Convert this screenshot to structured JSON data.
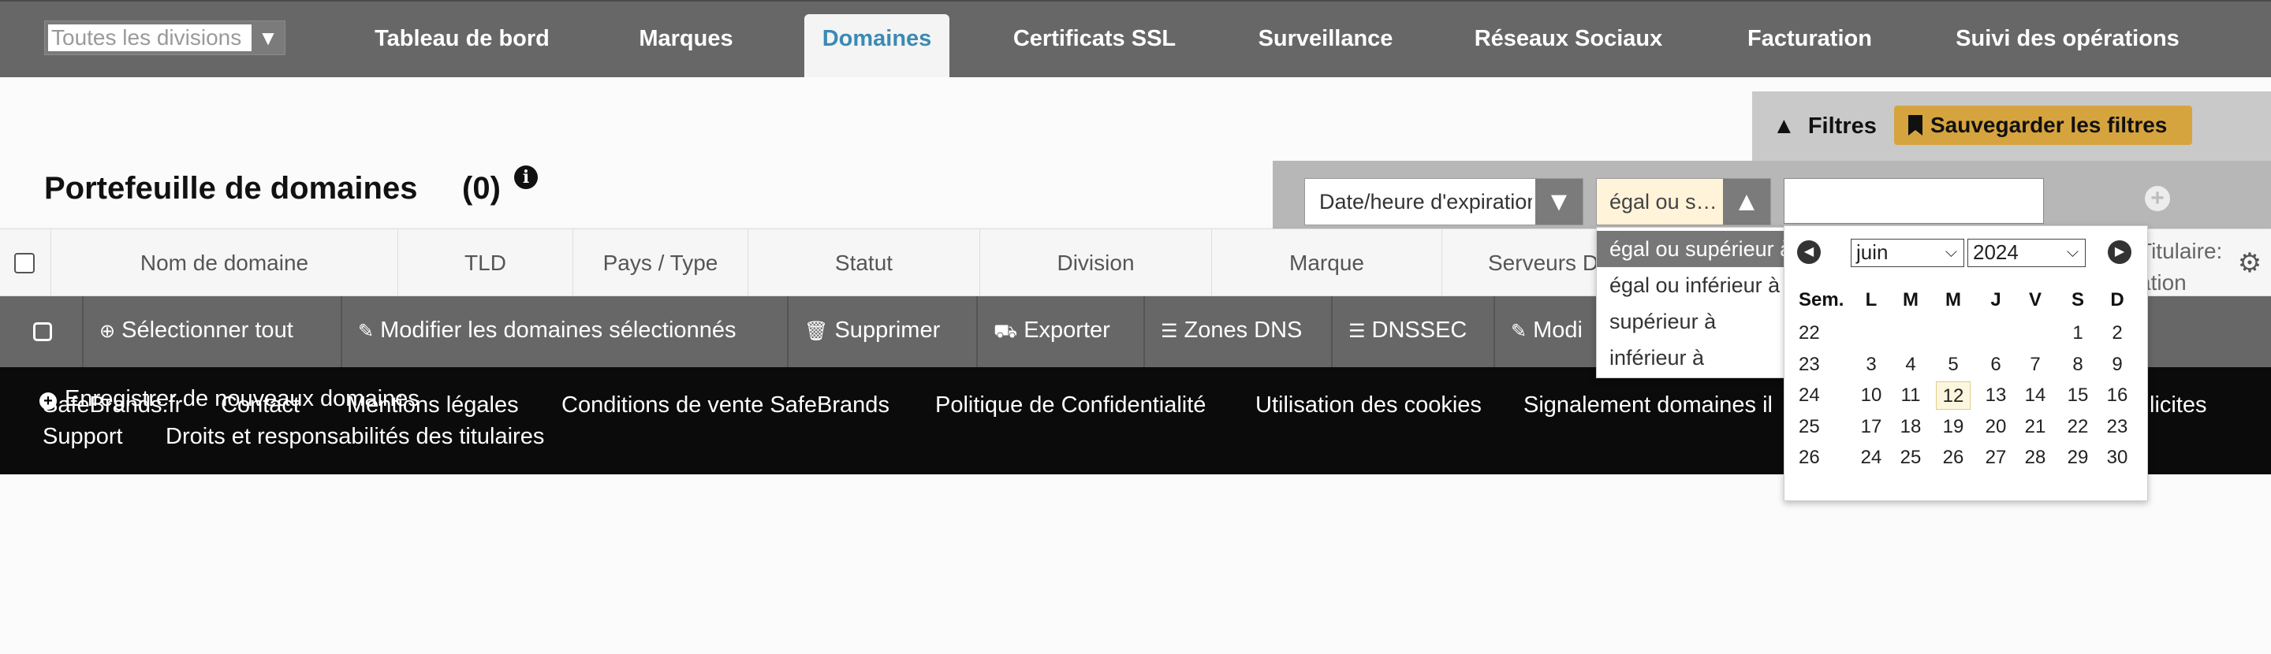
{
  "topnav": {
    "division_placeholder": "Toutes les divisions",
    "items": [
      {
        "label": "Tableau de bord"
      },
      {
        "label": "Marques"
      },
      {
        "label": "Domaines",
        "active": true
      },
      {
        "label": "Certificats SSL"
      },
      {
        "label": "Surveillance"
      },
      {
        "label": "Réseaux Sociaux"
      },
      {
        "label": "Facturation"
      },
      {
        "label": "Suivi des opérations"
      }
    ]
  },
  "page": {
    "title": "Portefeuille de domaines",
    "count": "(0)"
  },
  "filters": {
    "toggle_label": "Filtres",
    "save_label": "Sauvegarder les filtres",
    "field_value": "Date/heure d'expiration",
    "operator_value": "égal ou s…",
    "operator_options": [
      "égal ou supérieur à",
      "égal ou inférieur à",
      "supérieur à",
      "inférieur à"
    ],
    "value": ""
  },
  "datepicker": {
    "month": "juin",
    "year": "2024",
    "headers": [
      "Sem.",
      "L",
      "M",
      "M",
      "J",
      "V",
      "S",
      "D"
    ],
    "weeks": [
      {
        "week": "22",
        "days": [
          "",
          "",
          "",
          "",
          "",
          "1",
          "2"
        ]
      },
      {
        "week": "23",
        "days": [
          "3",
          "4",
          "5",
          "6",
          "7",
          "8",
          "9"
        ]
      },
      {
        "week": "24",
        "days": [
          "10",
          "11",
          "12",
          "13",
          "14",
          "15",
          "16"
        ]
      },
      {
        "week": "25",
        "days": [
          "17",
          "18",
          "19",
          "20",
          "21",
          "22",
          "23"
        ]
      },
      {
        "week": "26",
        "days": [
          "24",
          "25",
          "26",
          "27",
          "28",
          "29",
          "30"
        ]
      }
    ],
    "today": "12"
  },
  "table": {
    "columns": [
      "Nom de domaine",
      "TLD",
      "Pays / Type",
      "Statut",
      "Division",
      "Marque",
      "Serveurs D"
    ],
    "owner_col_line1": "Titulaire:",
    "owner_col_line2": "ation"
  },
  "actions": {
    "select_all": "Sélectionner tout",
    "edit_selected": "Modifier les domaines sélectionnés",
    "delete": "Supprimer",
    "export": "Exporter",
    "dns_zones": "Zones DNS",
    "dnssec": "DNSSEC",
    "modify": "Modi"
  },
  "footer": {
    "register": "Enregistrer de nouveaux domaines",
    "links_row1": [
      "SafeBrands.fr",
      "Contact",
      "Mentions légales",
      "Conditions de vente SafeBrands",
      "Politique de Confidentialité",
      "Utilisation des cookies",
      "Signalement domaines il",
      "licites"
    ],
    "links_row2": [
      "Support",
      "Droits et responsabilités des titulaires"
    ]
  },
  "icons": {
    "caret_down": "▼",
    "caret_up": "▲",
    "bookmark": "bookmark-icon",
    "plus_circle": "plus-circle-icon",
    "info": "info-icon",
    "gear": "gear-icon"
  }
}
